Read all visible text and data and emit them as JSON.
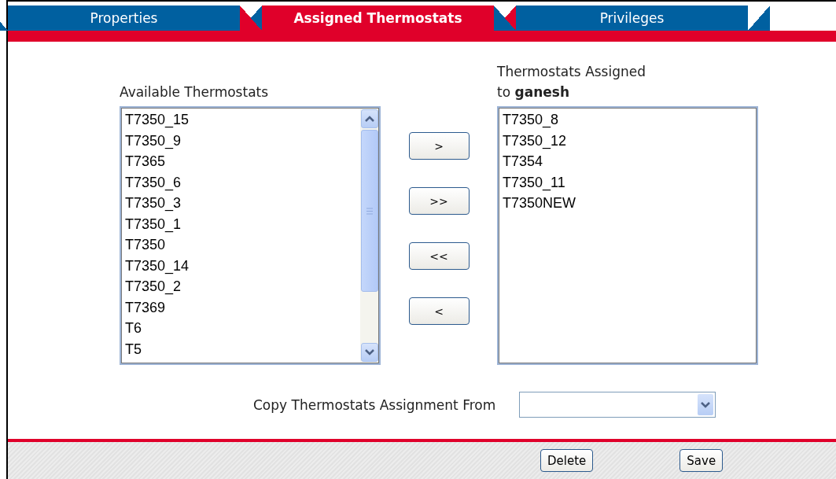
{
  "tabs": [
    {
      "label": "Properties",
      "selected": false
    },
    {
      "label": "Assigned Thermostats",
      "selected": true
    },
    {
      "label": "Privileges",
      "selected": false
    }
  ],
  "available": {
    "label": "Available Thermostats",
    "items": [
      "T7350_15",
      "T7350_9",
      "T7365",
      "T7350_6",
      "T7350_3",
      "T7350_1",
      "T7350",
      "T7350_14",
      "T7350_2",
      "T7369",
      "T6",
      "T5"
    ]
  },
  "move_buttons": [
    ">",
    ">>",
    "<<",
    "<"
  ],
  "assigned": {
    "label": "Thermostats Assigned",
    "label_2": "to **ganesh**",
    "items": [
      "T7350_8",
      "T7350_12",
      "T7354",
      "T7350_11",
      "T7350NEW"
    ]
  },
  "copy_from": {
    "label": "Copy Thermostats Assignment From"
  },
  "footer_buttons": [
    "Delete",
    "Save"
  ]
}
